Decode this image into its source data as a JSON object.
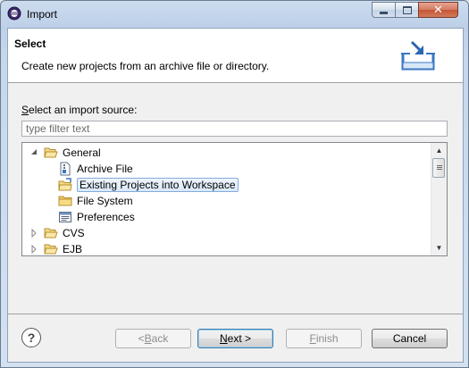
{
  "window": {
    "title": "Import"
  },
  "header": {
    "title": "Select",
    "description": "Create new projects from an archive file or directory."
  },
  "source": {
    "label_prefix": "",
    "label_accel": "S",
    "label_rest": "elect an import source:",
    "filter_placeholder": "type filter text"
  },
  "tree": {
    "items": [
      {
        "label": "General",
        "level": 0,
        "expanded": true,
        "icon": "folder-open-icon"
      },
      {
        "label": "Archive File",
        "level": 1,
        "icon": "archive-file-icon"
      },
      {
        "label": "Existing Projects into Workspace",
        "level": 1,
        "icon": "existing-projects-icon",
        "selected": true
      },
      {
        "label": "File System",
        "level": 1,
        "icon": "folder-icon"
      },
      {
        "label": "Preferences",
        "level": 1,
        "icon": "preferences-icon"
      },
      {
        "label": "CVS",
        "level": 0,
        "expanded": false,
        "icon": "folder-icon"
      },
      {
        "label": "EJB",
        "level": 0,
        "expanded": false,
        "icon": "folder-icon"
      }
    ]
  },
  "buttons": {
    "back_pre": "< ",
    "back_accel": "B",
    "back_rest": "ack",
    "next_pre": "",
    "next_accel": "N",
    "next_rest": "ext >",
    "finish_accel": "F",
    "finish_rest": "inish",
    "cancel": "Cancel",
    "help": "?"
  },
  "colors": {
    "selection_border": "#84acdd",
    "folder_yellow": "#e8c25a",
    "header_icon_blue": "#3a77c3"
  }
}
